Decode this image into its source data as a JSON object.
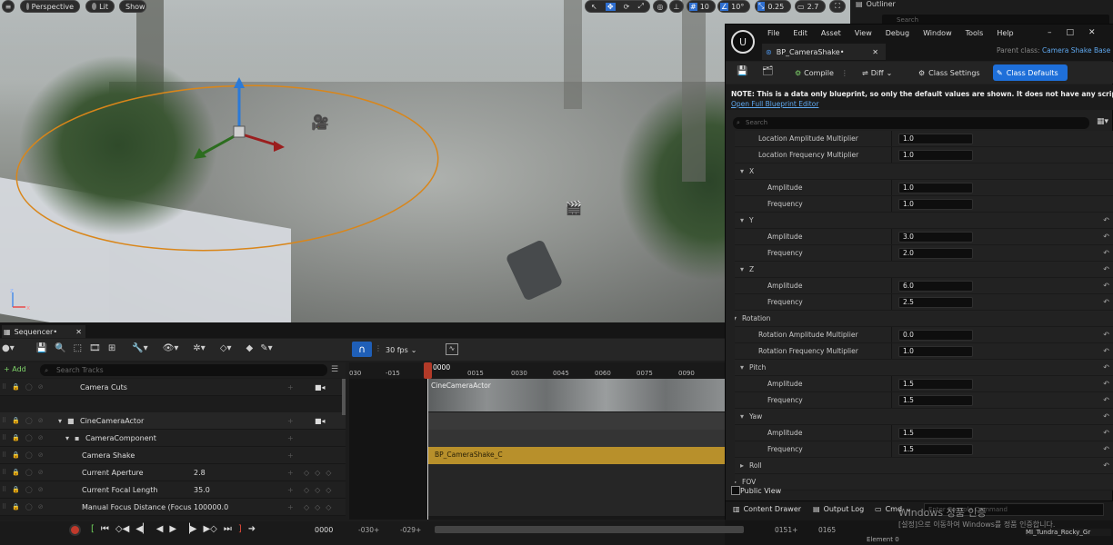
{
  "viewport": {
    "perspective": "Perspective",
    "lit": "Lit",
    "show": "Show",
    "grid_value": "10",
    "rot_value": "10°",
    "scale_value": "0.25",
    "cam_speed": "2.7"
  },
  "outliner": {
    "title": "Outliner",
    "search_placeholder": "Search"
  },
  "bp": {
    "menus": [
      "File",
      "Edit",
      "Asset",
      "View",
      "Debug",
      "Window",
      "Tools",
      "Help"
    ],
    "tab": "BP_CameraShake•",
    "parent_label": "Parent class:",
    "parent_value": "Camera Shake Base",
    "compile": "Compile",
    "diff": "Diff",
    "class_settings": "Class Settings",
    "class_defaults": "Class Defaults",
    "note": "NOTE: This is a data only blueprint, so only the default values are shown.  It does not have any script or variable",
    "open_full": "Open Full Blueprint Editor",
    "search_placeholder": "Search",
    "rows": [
      {
        "label": "Location Amplitude Multiplier",
        "value": "1.0"
      },
      {
        "label": "Location Frequency Multiplier",
        "value": "1.0"
      },
      {
        "label": "X",
        "value": ""
      },
      {
        "label": "Amplitude",
        "value": "1.0"
      },
      {
        "label": "Frequency",
        "value": "1.0"
      },
      {
        "label": "Y",
        "value": ""
      },
      {
        "label": "Amplitude",
        "value": "3.0"
      },
      {
        "label": "Frequency",
        "value": "2.0"
      },
      {
        "label": "Z",
        "value": ""
      },
      {
        "label": "Amplitude",
        "value": "6.0"
      },
      {
        "label": "Frequency",
        "value": "2.5"
      },
      {
        "label": "Rotation",
        "value": ""
      },
      {
        "label": "Rotation Amplitude Multiplier",
        "value": "0.0"
      },
      {
        "label": "Rotation Frequency Multiplier",
        "value": "1.0"
      },
      {
        "label": "Pitch",
        "value": ""
      },
      {
        "label": "Amplitude",
        "value": "1.5"
      },
      {
        "label": "Frequency",
        "value": "1.5"
      },
      {
        "label": "Yaw",
        "value": ""
      },
      {
        "label": "Amplitude",
        "value": "1.5"
      },
      {
        "label": "Frequency",
        "value": "1.5"
      },
      {
        "label": "Roll",
        "value": ""
      },
      {
        "label": "FOV",
        "value": ""
      }
    ],
    "public_view": "Public View",
    "content_drawer": "Content Drawer",
    "output_log": "Output Log",
    "cmd": "Cmd",
    "cmd_placeholder": "Enter Console Command"
  },
  "sequencer": {
    "tab": "Sequencer•",
    "fps": "30 fps",
    "add": "+ Add",
    "search_placeholder": "Search Tracks",
    "playhead": "0000",
    "ticks": [
      "030",
      "-015",
      "0015",
      "0030",
      "0045",
      "0060",
      "0075",
      "0090"
    ],
    "tracks": [
      {
        "name": "Camera Cuts",
        "value": ""
      },
      {
        "name": "CineCameraActor",
        "value": ""
      },
      {
        "name": "CameraComponent",
        "value": ""
      },
      {
        "name": "Camera Shake",
        "value": ""
      },
      {
        "name": "Current Aperture",
        "value": "2.8"
      },
      {
        "name": "Current Focal Length",
        "value": "35.0"
      },
      {
        "name": "Manual Focus Distance (Focus",
        "value": "100000.0"
      }
    ],
    "section_cine": "CineCameraActor",
    "section_shake": "BP_CameraShake_C",
    "frame": "0000",
    "start_a": "-030+",
    "start_b": "-029+",
    "end_a": "0151+",
    "end_b": "0165"
  },
  "windows": {
    "line1": "Windows 정품 인증",
    "line2": "[설정]으로 이동하여 Windows를 정품 인증합니다."
  },
  "status": {
    "asset": "MI_Tundra_Rocky_Gr",
    "elements": "Element 0"
  }
}
